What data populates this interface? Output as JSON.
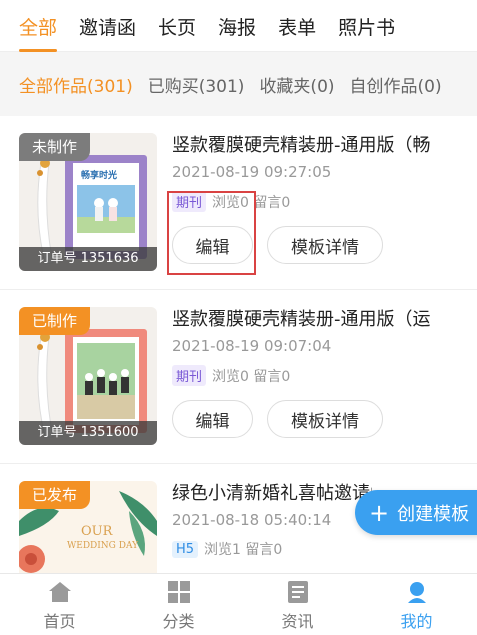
{
  "top_tabs": [
    {
      "label": "全部",
      "active": true
    },
    {
      "label": "邀请函",
      "active": false
    },
    {
      "label": "长页",
      "active": false
    },
    {
      "label": "海报",
      "active": false
    },
    {
      "label": "表单",
      "active": false
    },
    {
      "label": "照片书",
      "active": false
    }
  ],
  "filters": [
    {
      "label": "全部作品(301)",
      "active": true
    },
    {
      "label": "已购买(301)",
      "active": false
    },
    {
      "label": "收藏夹(0)",
      "active": false
    },
    {
      "label": "自创作品(0)",
      "active": false
    }
  ],
  "works": [
    {
      "status": "未制作",
      "order": "订单号 1351636",
      "title": "竖款覆膜硬壳精装册-通用版（畅",
      "date": "2021-08-19 09:27:05",
      "tag": "期刊",
      "stats": "浏览0 留言0",
      "edit_label": "编辑",
      "detail_label": "模板详情",
      "thumb_text": "畅享时光"
    },
    {
      "status": "已制作",
      "order": "订单号 1351600",
      "title": "竖款覆膜硬壳精装册-通用版（运",
      "date": "2021-08-19 09:07:04",
      "tag": "期刊",
      "stats": "浏览0 留言0",
      "edit_label": "编辑",
      "detail_label": "模板详情"
    },
    {
      "status": "已发布",
      "title": "绿色小清新婚礼喜帖邀请函",
      "date": "2021-08-18 05:40:14",
      "tag": "H5",
      "stats": "浏览1 留言0",
      "thumb_text_1": "OUR",
      "thumb_text_2": "WEDDING DAY"
    }
  ],
  "create_button": {
    "label": "创建模板"
  },
  "bottom_nav": [
    {
      "label": "首页",
      "icon": "home-icon"
    },
    {
      "label": "分类",
      "icon": "grid-icon"
    },
    {
      "label": "资讯",
      "icon": "news-icon"
    },
    {
      "label": "我的",
      "icon": "profile-icon",
      "active": true
    }
  ],
  "colors": {
    "accent": "#f39124",
    "primary_blue": "#3aa0f0",
    "highlight_red": "#d94343"
  }
}
